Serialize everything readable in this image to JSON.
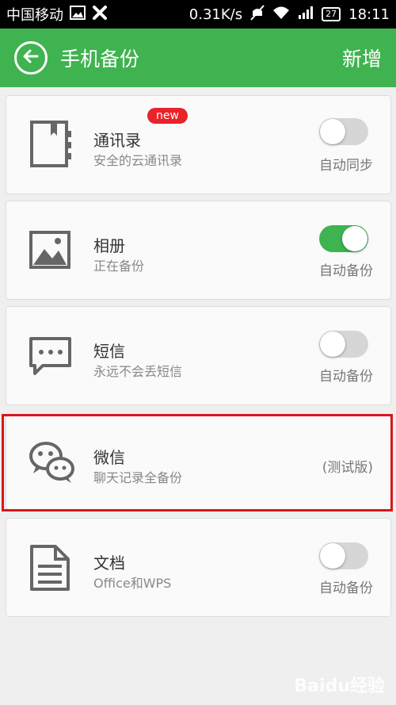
{
  "status_bar": {
    "carrier": "中国移动",
    "net_speed": "0.31K/s",
    "battery": "27",
    "time": "18:11"
  },
  "app_bar": {
    "title": "手机备份",
    "action_label": "新增"
  },
  "items": [
    {
      "name": "通讯录",
      "desc": "安全的云通讯录",
      "badge": "new",
      "toggle_on": false,
      "right_label": "自动同步",
      "icon": "contacts-book-icon"
    },
    {
      "name": "相册",
      "desc": "正在备份",
      "toggle_on": true,
      "right_label": "自动备份",
      "icon": "photo-icon"
    },
    {
      "name": "短信",
      "desc": "永远不会丢短信",
      "toggle_on": false,
      "right_label": "自动备份",
      "icon": "sms-icon"
    },
    {
      "name": "微信",
      "desc": "聊天记录全备份",
      "right_label": "(测试版)",
      "icon": "wechat-icon"
    },
    {
      "name": "文档",
      "desc": "Office和WPS",
      "toggle_on": false,
      "right_label": "自动备份",
      "icon": "document-icon"
    }
  ],
  "watermark": "Baidu经验",
  "colors": {
    "accent": "#3fb34f",
    "badge": "#e8232a",
    "highlight": "#d9161c"
  }
}
